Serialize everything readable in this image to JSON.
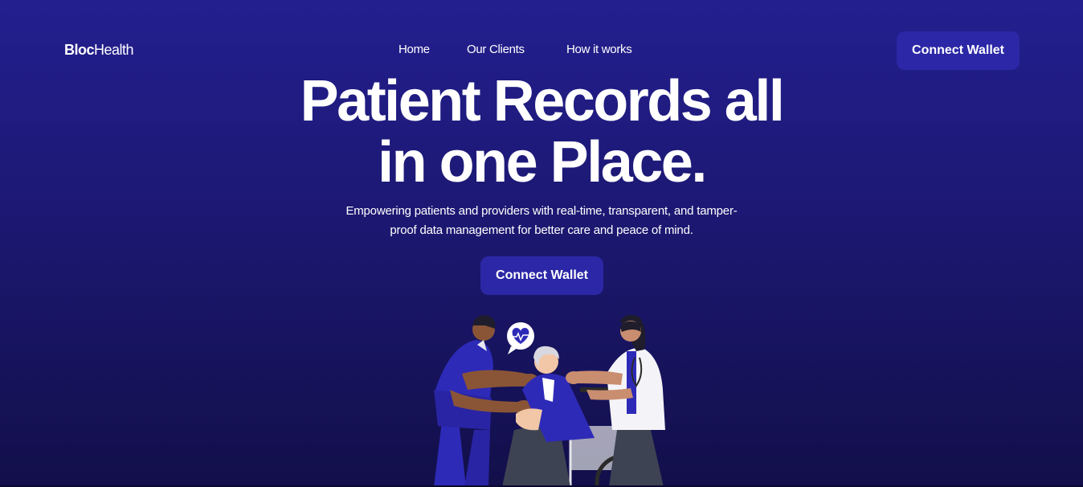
{
  "brand": {
    "bold": "Bloc",
    "regular": "Health"
  },
  "nav": {
    "items": [
      {
        "label": "Home"
      },
      {
        "label": "Our Clients"
      },
      {
        "label": "How it works"
      }
    ]
  },
  "header": {
    "cta_label": "Connect Wallet"
  },
  "hero": {
    "title_line1": "Patient Records all",
    "title_line2": "in one Place.",
    "subtitle_line1": "Empowering patients and providers with real-time, transparent, and tamper-",
    "subtitle_line2": "proof data management for better care and peace of mind.",
    "cta_label": "Connect Wallet"
  },
  "colors": {
    "background_top": "#231f8f",
    "background_bottom": "#120f4a",
    "button": "#2b27a6",
    "text": "#ffffff"
  }
}
